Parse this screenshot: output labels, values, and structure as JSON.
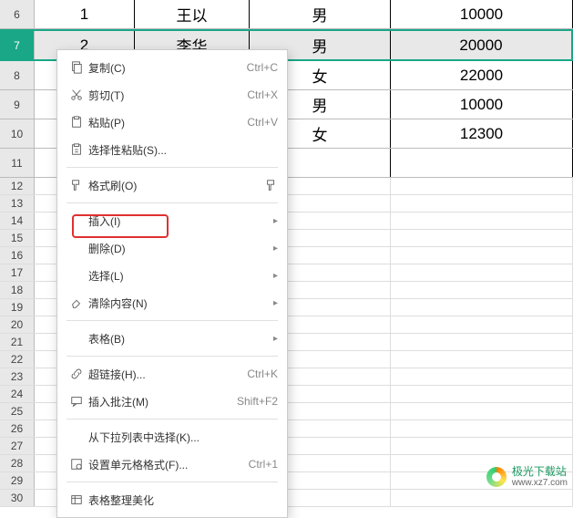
{
  "rows": [
    {
      "num": "6",
      "a": "1",
      "b": "王以",
      "c": "男",
      "d": "10000",
      "h": "tall",
      "sel": false
    },
    {
      "num": "7",
      "a": "2",
      "b": "李华",
      "c": "男",
      "d": "20000",
      "h": "tall",
      "sel": true
    },
    {
      "num": "8",
      "a": "",
      "b": "",
      "c": "女",
      "d": "22000",
      "h": "tall",
      "sel": false,
      "tr": true
    },
    {
      "num": "9",
      "a": "",
      "b": "",
      "c": "男",
      "d": "10000",
      "h": "tall",
      "sel": false,
      "tr": true
    },
    {
      "num": "10",
      "a": "",
      "b": "",
      "c": "女",
      "d": "12300",
      "h": "tall",
      "sel": false,
      "tr": true
    },
    {
      "num": "11",
      "a": "",
      "b": "",
      "c": "",
      "d": "",
      "h": "tall",
      "sel": false,
      "tr": true
    },
    {
      "num": "12",
      "h": "short",
      "tr": true
    },
    {
      "num": "13",
      "h": "short",
      "tr": true
    },
    {
      "num": "14",
      "h": "short",
      "tr": true
    },
    {
      "num": "15",
      "h": "short",
      "tr": true
    },
    {
      "num": "16",
      "h": "short",
      "tr": true
    },
    {
      "num": "17",
      "h": "short",
      "tr": true
    },
    {
      "num": "18",
      "h": "short",
      "tr": true
    },
    {
      "num": "19",
      "h": "short",
      "tr": true
    },
    {
      "num": "20",
      "h": "short",
      "tr": true
    },
    {
      "num": "21",
      "h": "short",
      "tr": true
    },
    {
      "num": "22",
      "h": "short",
      "tr": true
    },
    {
      "num": "23",
      "h": "short",
      "tr": true
    },
    {
      "num": "24",
      "h": "short",
      "tr": true
    },
    {
      "num": "25",
      "h": "short",
      "tr": true
    },
    {
      "num": "26",
      "h": "short",
      "tr": true
    },
    {
      "num": "27",
      "h": "short",
      "tr": true
    },
    {
      "num": "28",
      "h": "short",
      "tr": true
    },
    {
      "num": "29",
      "h": "short",
      "tr": true
    },
    {
      "num": "30",
      "h": "short",
      "tr": true
    }
  ],
  "ctx": {
    "copy": {
      "label": "复制(C)",
      "shortcut": "Ctrl+C"
    },
    "cut": {
      "label": "剪切(T)",
      "shortcut": "Ctrl+X"
    },
    "paste": {
      "label": "粘贴(P)",
      "shortcut": "Ctrl+V"
    },
    "paste_special": {
      "label": "选择性粘贴(S)..."
    },
    "format_painter": {
      "label": "格式刷(O)"
    },
    "insert": {
      "label": "插入(I)"
    },
    "delete": {
      "label": "删除(D)"
    },
    "select": {
      "label": "选择(L)"
    },
    "clear": {
      "label": "清除内容(N)"
    },
    "table": {
      "label": "表格(B)"
    },
    "hyperlink": {
      "label": "超链接(H)...",
      "shortcut": "Ctrl+K"
    },
    "comment": {
      "label": "插入批注(M)",
      "shortcut": "Shift+F2"
    },
    "dropdown": {
      "label": "从下拉列表中选择(K)..."
    },
    "format_cells": {
      "label": "设置单元格格式(F)...",
      "shortcut": "Ctrl+1"
    },
    "beautify": {
      "label": "表格整理美化"
    }
  },
  "watermark": {
    "line1": "极光下载站",
    "line2": "www.xz7.com"
  }
}
